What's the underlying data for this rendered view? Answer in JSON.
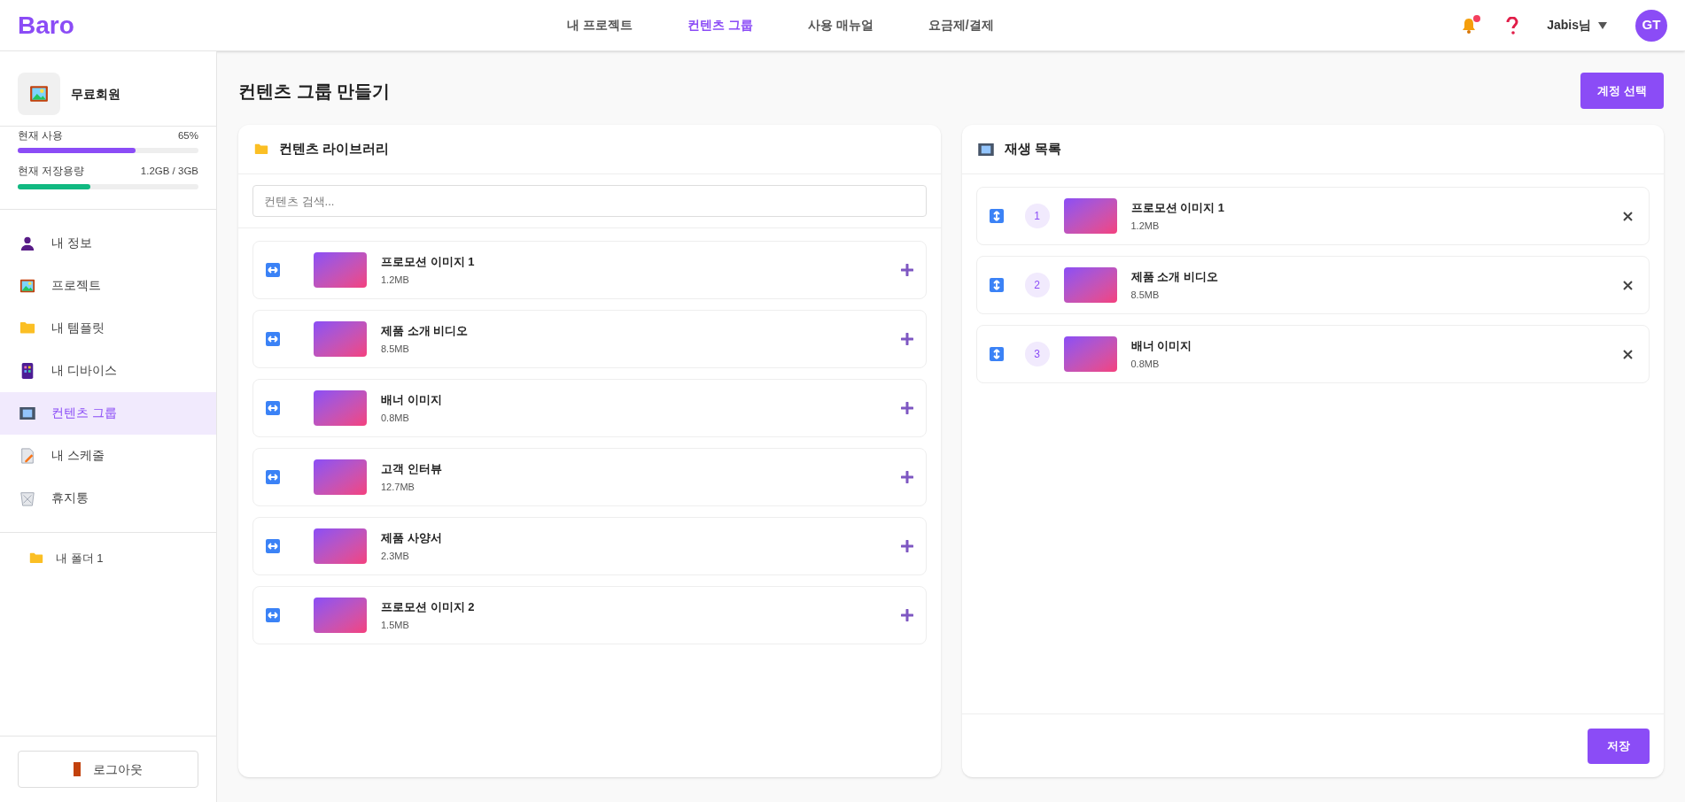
{
  "header": {
    "logo": "Baro",
    "nav": [
      {
        "label": "내 프로젝트",
        "selected": false
      },
      {
        "label": "컨텐츠 그룹",
        "selected": true
      },
      {
        "label": "사용 매뉴얼",
        "selected": false
      },
      {
        "label": "요금제/결제",
        "selected": false
      }
    ],
    "notification_unread": true,
    "user_name": "Jabis님",
    "avatar": "GT"
  },
  "sidebar": {
    "plan": "무료회원",
    "usage": [
      {
        "label": "현재 사용",
        "value": "65%",
        "level": 0.65,
        "color": "#8b4cf6"
      },
      {
        "label": "현재 저장용량",
        "value": "1.2GB / 3GB",
        "level": 0.4,
        "color": "#10b981"
      }
    ],
    "items": [
      {
        "label": "내 정보",
        "selected": false
      },
      {
        "label": "프로젝트",
        "selected": false
      },
      {
        "label": "내 템플릿",
        "selected": false
      },
      {
        "label": "내 디바이스",
        "selected": false
      },
      {
        "label": "컨텐츠 그룹",
        "selected": true
      },
      {
        "label": "내 스케줄",
        "selected": false
      },
      {
        "label": "휴지통",
        "selected": false
      }
    ],
    "folders": [
      {
        "label": "내 폴더 1"
      }
    ],
    "logout": "로그아웃"
  },
  "page": {
    "title": "컨텐츠 그룹 만들기",
    "account_button": "계정 선택"
  },
  "library": {
    "title": "컨텐츠 라이브러리",
    "search": {
      "placeholder": "컨텐츠 검색..."
    },
    "items": [
      {
        "name": "프로모션 이미지 1",
        "size": "1.2MB"
      },
      {
        "name": "제품 소개 비디오",
        "size": "8.5MB"
      },
      {
        "name": "배너 이미지",
        "size": "0.8MB"
      },
      {
        "name": "고객 인터뷰",
        "size": "12.7MB"
      },
      {
        "name": "제품 사양서",
        "size": "2.3MB"
      },
      {
        "name": "프로모션 이미지 2",
        "size": "1.5MB"
      }
    ]
  },
  "playlist": {
    "title": "재생 목록",
    "items": [
      {
        "number": "1",
        "name": "프로모션 이미지 1",
        "size": "1.2MB"
      },
      {
        "number": "2",
        "name": "제품 소개 비디오",
        "size": "8.5MB"
      },
      {
        "number": "3",
        "name": "배너 이미지",
        "size": "0.8MB"
      }
    ],
    "save_button": "저장"
  }
}
